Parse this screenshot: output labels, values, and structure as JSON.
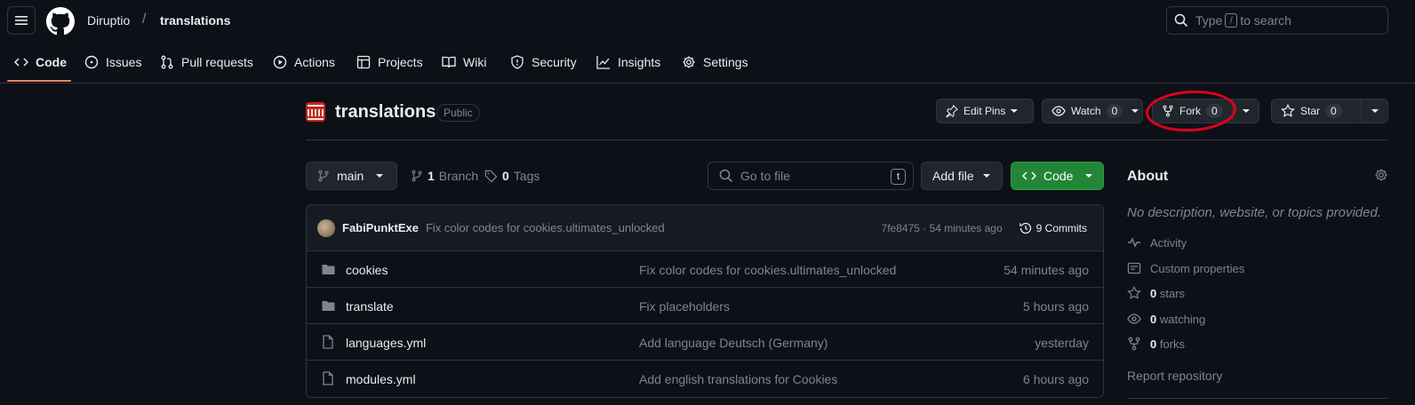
{
  "header": {
    "owner": "Diruptio",
    "separator": "/",
    "repo": "translations",
    "search_prefix": "Type",
    "search_key": "/",
    "search_suffix": "to search"
  },
  "nav": {
    "tabs": [
      {
        "label": "Code",
        "icon": "code-icon"
      },
      {
        "label": "Issues",
        "icon": "issue-icon"
      },
      {
        "label": "Pull requests",
        "icon": "pull-request-icon"
      },
      {
        "label": "Actions",
        "icon": "play-icon"
      },
      {
        "label": "Projects",
        "icon": "table-icon"
      },
      {
        "label": "Wiki",
        "icon": "book-icon"
      },
      {
        "label": "Security",
        "icon": "shield-icon"
      },
      {
        "label": "Insights",
        "icon": "graph-icon"
      },
      {
        "label": "Settings",
        "icon": "gear-icon"
      }
    ]
  },
  "repo": {
    "name": "translations",
    "visibility": "Public",
    "edit_pins": "Edit Pins",
    "watch_label": "Watch",
    "watch_count": "0",
    "fork_label": "Fork",
    "fork_count": "0",
    "star_label": "Star",
    "star_count": "0"
  },
  "filenav": {
    "branch": "main",
    "branch_count": "1",
    "branch_label": "Branch",
    "tag_count": "0",
    "tag_label": "Tags",
    "goto_placeholder": "Go to file",
    "goto_key": "t",
    "add_file": "Add file",
    "code_button": "Code"
  },
  "commit": {
    "author": "FabiPunktExe",
    "message": "Fix color codes for cookies.ultimates_unlocked",
    "hash_time": "7fe8475 · 54 minutes ago",
    "commits": "9 Commits"
  },
  "files": [
    {
      "type": "folder",
      "name": "cookies",
      "message": "Fix color codes for cookies.ultimates_unlocked",
      "time": "54 minutes ago"
    },
    {
      "type": "folder",
      "name": "translate",
      "message": "Fix placeholders",
      "time": "5 hours ago"
    },
    {
      "type": "file",
      "name": "languages.yml",
      "message": "Add language Deutsch (Germany)",
      "time": "yesterday"
    },
    {
      "type": "file",
      "name": "modules.yml",
      "message": "Add english translations for Cookies",
      "time": "6 hours ago"
    }
  ],
  "about": {
    "title": "About",
    "description": "No description, website, or topics provided.",
    "activity": "Activity",
    "custom_properties": "Custom properties",
    "stars_count": "0",
    "stars_label": "stars",
    "watching_count": "0",
    "watching_label": "watching",
    "forks_count": "0",
    "forks_label": "forks",
    "report": "Report repository"
  },
  "colors": {
    "background": "#0d1117",
    "border": "#30363d",
    "muted": "#7d8590",
    "accent_underline": "#f78166",
    "code_button": "#238636",
    "annotation": "#e0001b"
  }
}
